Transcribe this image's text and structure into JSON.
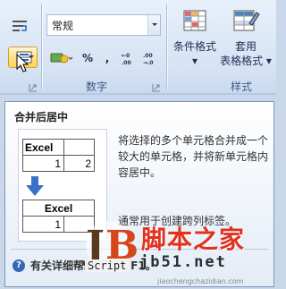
{
  "ribbon": {
    "number_format_value": "常规",
    "number_buttons": [
      "%",
      ","
    ],
    "number_group_label": "数字",
    "styles_group_label": "样式",
    "conditional_format": {
      "line1": "条件格式",
      "line2": "▾"
    },
    "table_format": {
      "line1": "套用",
      "line2": "表格格式 ▾"
    }
  },
  "tooltip": {
    "title": "合并后居中",
    "description": "将选择的多个单元格合并成一个较大的单元格，并将新单元格内容居中。",
    "extra": "通常用于创建跨列标签。",
    "help_text": "有关详细帮助，请按 F1。",
    "illustration": {
      "before_header": "Excel",
      "before_values": [
        "1",
        "2"
      ],
      "after_header": "Excel",
      "after_value": "1"
    }
  },
  "watermark": {
    "logo_letters": "JB",
    "script": "Script",
    "brand": "脚本之家",
    "url": "jb51.net",
    "small": "jiaochengchazidian.com"
  },
  "colors": {
    "accent": "#3566b8",
    "highlight": "#ffd25a",
    "watermark_red": "#e1321e"
  }
}
